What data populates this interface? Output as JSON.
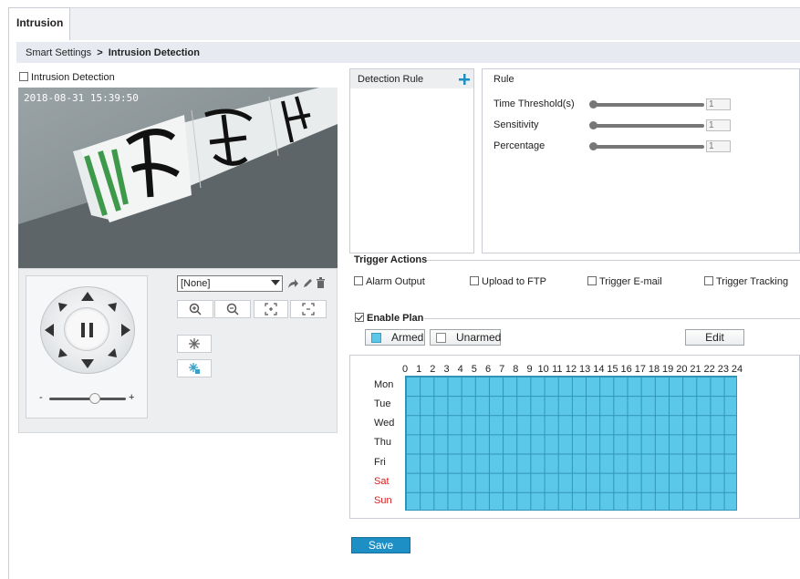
{
  "tab": {
    "label": "Intrusion"
  },
  "breadcrumb": {
    "parent": "Smart Settings",
    "separator": ">",
    "current": "Intrusion Detection"
  },
  "intrusion_detection": {
    "label": "Intrusion Detection",
    "checked": false
  },
  "video": {
    "timestamp": "2018-08-31 15:39:50"
  },
  "ptz": {
    "zoom_minus": "-",
    "zoom_plus": "+",
    "preset_value": "[None]"
  },
  "detection_rule": {
    "header": "Detection Rule",
    "add_icon": "plus-icon"
  },
  "rule": {
    "title": "Rule",
    "time_threshold_label": "Time Threshold(s)",
    "time_threshold_value": "1",
    "sensitivity_label": "Sensitivity",
    "sensitivity_value": "1",
    "percentage_label": "Percentage",
    "percentage_value": "1"
  },
  "trigger_actions": {
    "title": "Trigger Actions",
    "items": [
      {
        "label": "Alarm Output",
        "checked": false
      },
      {
        "label": "Upload to FTP",
        "checked": false
      },
      {
        "label": "Trigger E-mail",
        "checked": false
      },
      {
        "label": "Trigger Tracking",
        "checked": false
      }
    ]
  },
  "plan": {
    "enable_label": "Enable Plan",
    "enabled": true,
    "armed_label": "Armed",
    "unarmed_label": "Unarmed",
    "edit_label": "Edit",
    "armed_color": "#5bc8ea",
    "hours": [
      "0",
      "1",
      "2",
      "3",
      "4",
      "5",
      "6",
      "7",
      "8",
      "9",
      "10",
      "11",
      "12",
      "13",
      "14",
      "15",
      "16",
      "17",
      "18",
      "19",
      "20",
      "21",
      "22",
      "23",
      "24"
    ],
    "days": [
      {
        "label": "Mon",
        "weekend": false
      },
      {
        "label": "Tue",
        "weekend": false
      },
      {
        "label": "Wed",
        "weekend": false
      },
      {
        "label": "Thu",
        "weekend": false
      },
      {
        "label": "Fri",
        "weekend": false
      },
      {
        "label": "Sat",
        "weekend": true
      },
      {
        "label": "Sun",
        "weekend": true
      }
    ]
  },
  "save_label": "Save"
}
